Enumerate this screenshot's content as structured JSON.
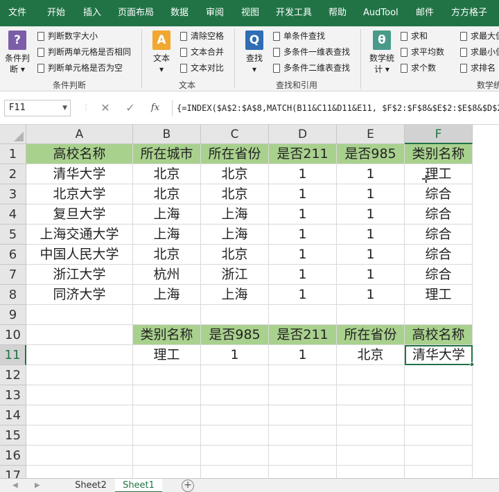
{
  "ribbon_tabs": [
    "文件",
    "开始",
    "插入",
    "页面布局",
    "数据",
    "审阅",
    "视图",
    "开发工具",
    "帮助",
    "AudTool",
    "邮件",
    "方方格子"
  ],
  "ribbon": {
    "groups": {
      "condition": {
        "label": "条件判断",
        "big_label_1": "条件判",
        "big_label_2": "断",
        "big_icon": "?",
        "items": [
          "判断数字大小",
          "判断两单元格是否相同",
          "判断单元格是否为空"
        ]
      },
      "text": {
        "label": "文本",
        "big_label": "文本",
        "big_icon": "A",
        "items": [
          "清除空格",
          "文本合并",
          "文本对比"
        ]
      },
      "lookup": {
        "label": "查找和引用",
        "big_label": "查找",
        "big_icon": "Q",
        "items": [
          "单条件查找",
          "多条件一维表查找",
          "多条件二维表查找"
        ]
      },
      "stats": {
        "label": "数学统",
        "big_label_1": "数学统",
        "big_label_2": "计",
        "big_icon": "θ",
        "items": [
          "求和",
          "求平均数",
          "求个数",
          "求最大值",
          "求最小值",
          "求排名"
        ]
      }
    }
  },
  "formula_bar": {
    "name_box": "F11",
    "cancel": "✕",
    "enter": "✓",
    "fx": "fx",
    "formula": "{=INDEX($A$2:$A$8,MATCH(B11&C11&D11&E11, $F$2:$F$8&$E$2:$E$8&$D$2"
  },
  "grid": {
    "columns": [
      "A",
      "B",
      "C",
      "D",
      "E",
      "F"
    ],
    "rows": [
      [
        "高校名称",
        "所在城市",
        "所在省份",
        "是否211",
        "是否985",
        "类别名称"
      ],
      [
        "清华大学",
        "北京",
        "北京",
        "1",
        "1",
        "理工"
      ],
      [
        "北京大学",
        "北京",
        "北京",
        "1",
        "1",
        "综合"
      ],
      [
        "复旦大学",
        "上海",
        "上海",
        "1",
        "1",
        "综合"
      ],
      [
        "上海交通大学",
        "上海",
        "上海",
        "1",
        "1",
        "综合"
      ],
      [
        "中国人民大学",
        "北京",
        "北京",
        "1",
        "1",
        "综合"
      ],
      [
        "浙江大学",
        "杭州",
        "浙江",
        "1",
        "1",
        "综合"
      ],
      [
        "同济大学",
        "上海",
        "上海",
        "1",
        "1",
        "理工"
      ],
      [
        "",
        "",
        "",
        "",
        "",
        ""
      ],
      [
        "",
        "类别名称",
        "是否985",
        "是否211",
        "所在省份",
        "高校名称"
      ],
      [
        "",
        "理工",
        "1",
        "1",
        "北京",
        "清华大学"
      ],
      [
        "",
        "",
        "",
        "",
        "",
        ""
      ],
      [
        "",
        "",
        "",
        "",
        "",
        ""
      ],
      [
        "",
        "",
        "",
        "",
        "",
        ""
      ],
      [
        "",
        "",
        "",
        "",
        "",
        ""
      ],
      [
        "",
        "",
        "",
        "",
        "",
        ""
      ],
      [
        "",
        "",
        "",
        "",
        "",
        ""
      ]
    ],
    "row_numbers": [
      "1",
      "2",
      "3",
      "4",
      "5",
      "6",
      "7",
      "8",
      "9",
      "10",
      "11",
      "12",
      "13",
      "14",
      "15",
      "16",
      "17"
    ],
    "active_cell": "F11",
    "header_fill": "#a9d18e",
    "accent": "#217346"
  },
  "sheets": {
    "tabs": [
      "Sheet2",
      "Sheet1"
    ],
    "active": "Sheet1",
    "add_label": "+"
  }
}
